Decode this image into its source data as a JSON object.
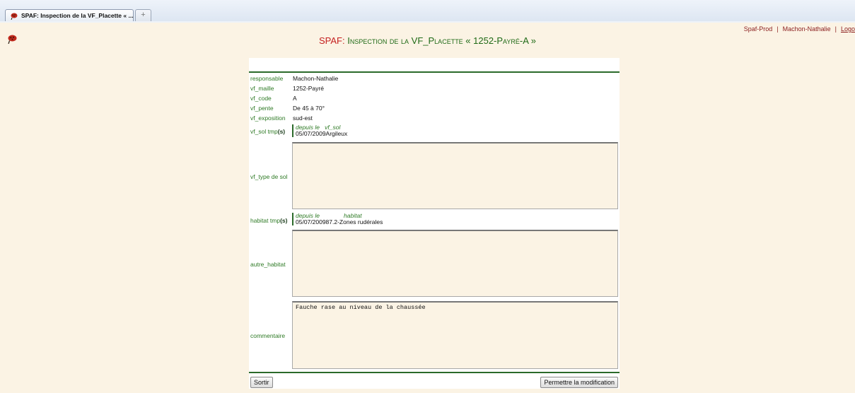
{
  "browser": {
    "tab_title": "SPAF: Inspection de la VF_Placette « ...",
    "new_tab_symbol": "+"
  },
  "header": {
    "links": [
      "Spaf-Prod",
      "Machon-Nathalie",
      "Logo"
    ],
    "separator": "|",
    "title_brand": "SPAF:",
    "title_rest": "Inspection de la VF_Placette « 1252-Payré-A »"
  },
  "form": {
    "fields": [
      {
        "label": "responsable",
        "value": "Machon-Nathalie"
      },
      {
        "label": "vf_maille",
        "value": "1252-Payré"
      },
      {
        "label": "vf_code",
        "value": "A"
      },
      {
        "label": "vf_pente",
        "value": "De 45 à 70°"
      },
      {
        "label": "vf_exposition",
        "value": "sud-est"
      }
    ],
    "sol_tmp": {
      "label": "vf_sol tmp",
      "label_suffix": "(s)",
      "col1": "depuis le",
      "col2": "vf_sol",
      "date": "05/07/2009",
      "value": "Argileux"
    },
    "type_sol": {
      "label": "vf_type de sol",
      "value": ""
    },
    "habitat_tmp": {
      "label": "habitat tmp",
      "label_suffix": "(s)",
      "col1": "depuis le",
      "col2": "habitat",
      "date": "05/07/2009",
      "value": "87.2-Zones rudérales"
    },
    "autre_habitat": {
      "label": "autre_habitat",
      "value": ""
    },
    "commentaire": {
      "label": "commentaire",
      "value": "Fauche rase au niveau de la chaussée"
    }
  },
  "buttons": {
    "sortir": "Sortir",
    "permettre": "Permettre la modification"
  },
  "colors": {
    "background": "#fbf3e4",
    "label_green": "#2e7a25",
    "title_red": "#c41f1f",
    "rule_green": "#2b6a2a"
  }
}
